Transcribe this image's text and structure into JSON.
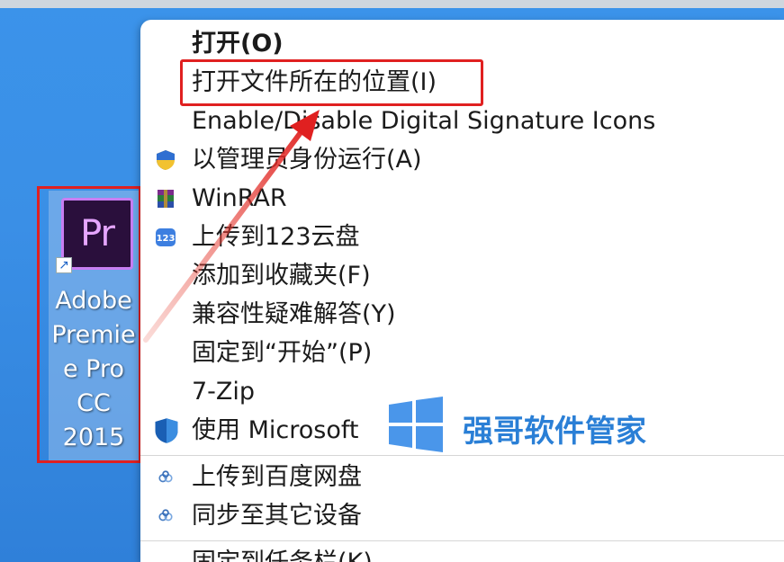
{
  "desktop": {
    "icon": {
      "tile_text": "Pr",
      "label_lines": [
        "Adobe",
        "Premie",
        "e Pro",
        "CC",
        "2015"
      ]
    }
  },
  "context_menu": {
    "items": [
      {
        "label": "打开(O)",
        "icon": "none",
        "bold": true
      },
      {
        "label": "打开文件所在的位置(I)",
        "icon": "none",
        "highlighted": true
      },
      {
        "label": "Enable/Disable Digital Signature Icons",
        "icon": "none"
      },
      {
        "label": "以管理员身份运行(A)",
        "icon": "uac-shield-icon"
      },
      {
        "label": "WinRAR",
        "icon": "winrar-icon"
      },
      {
        "label": "上传到123云盘",
        "icon": "123-cloud-icon"
      },
      {
        "label": "添加到收藏夹(F)",
        "icon": "none"
      },
      {
        "label": "兼容性疑难解答(Y)",
        "icon": "none"
      },
      {
        "label": "固定到“开始”(P)",
        "icon": "none"
      },
      {
        "label": "7-Zip",
        "icon": "none"
      },
      {
        "label": "使用 Microsoft",
        "icon": "defender-shield-icon"
      },
      {
        "label": "上传到百度网盘",
        "icon": "baidu-netdisk-icon"
      },
      {
        "label": "同步至其它设备",
        "icon": "baidu-netdisk-icon"
      },
      {
        "label": "固定到任务栏(K)",
        "icon": "none"
      }
    ]
  },
  "watermark": {
    "text": "强哥软件管家",
    "icon": "windows-logo-icon"
  },
  "colors": {
    "highlight_red": "#e02020",
    "desktop_blue": "#3a8fe8",
    "watermark_blue": "#2a7fd6"
  }
}
